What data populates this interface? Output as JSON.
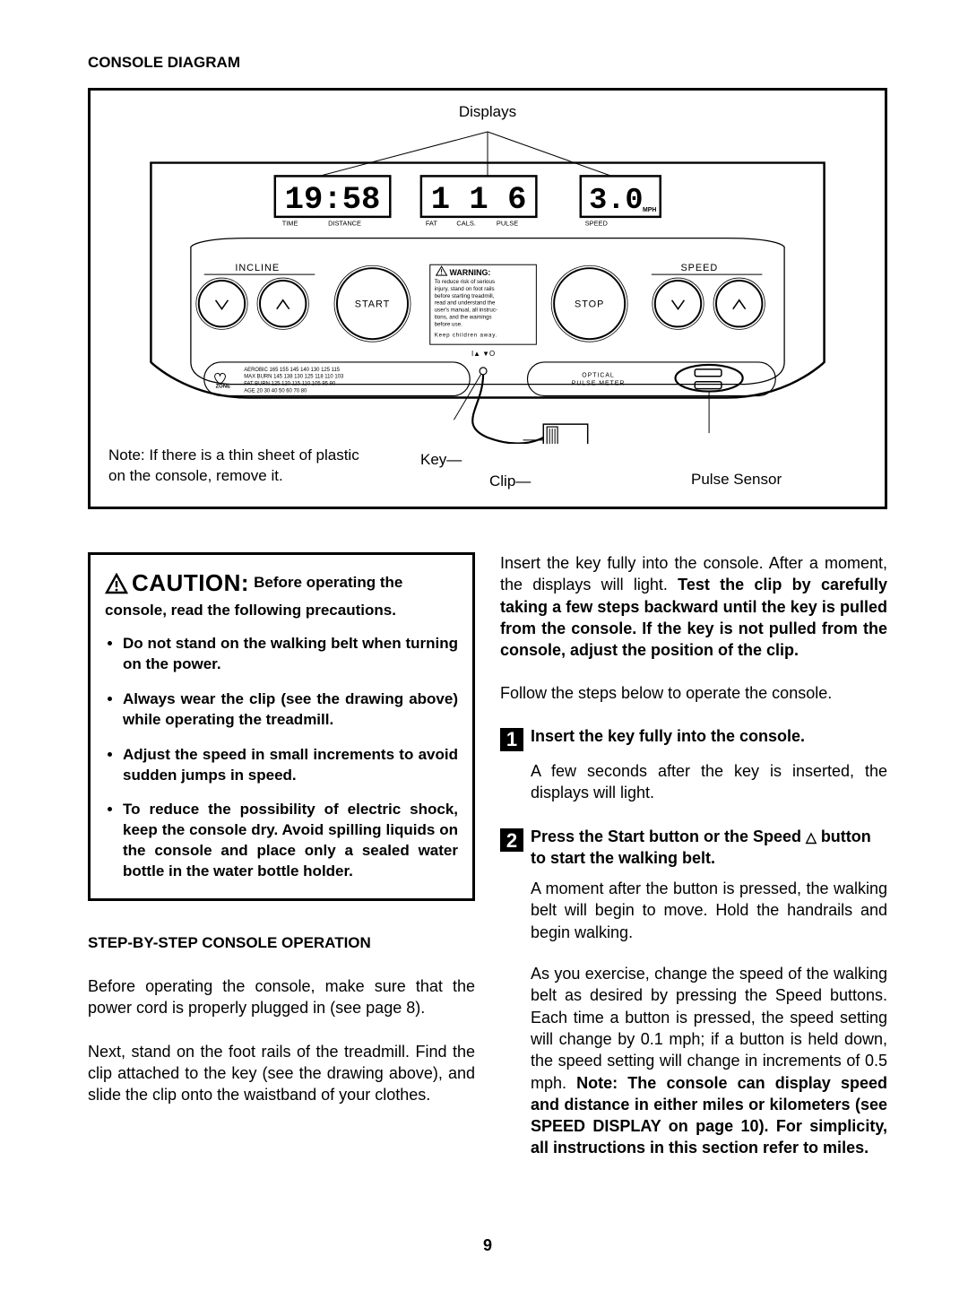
{
  "header": {
    "title": "CONSOLE DIAGRAM"
  },
  "diagram": {
    "callouts": {
      "displays": "Displays",
      "key": "Key",
      "clip": "Clip",
      "pulse_sensor": "Pulse Sensor"
    },
    "note": "Note: If there is a thin sheet of plastic on the console, remove it.",
    "lcds": {
      "time_val": "19:58",
      "fat_val": "1 1 6",
      "speed_val": "3.0",
      "speed_unit": "MPH"
    },
    "lcd_labels": {
      "time": "TIME",
      "distance": "DISTANCE",
      "fat": "FAT",
      "cals": "CALS.",
      "pulse": "PULSE",
      "speed": "SPEED"
    },
    "labels": {
      "incline": "INCLINE",
      "speed": "SPEED",
      "start": "START",
      "stop": "STOP"
    },
    "warning": {
      "title": "WARNING:",
      "lines": [
        "To reduce risk of serious",
        "injury, stand on foot rails",
        "before starting treadmill,",
        "read and understand the",
        "user's manual, all instruc-",
        "tions, and the warnings",
        "before use.",
        "Keep children away."
      ]
    },
    "selectors": "I▲   ▼O",
    "optical": {
      "l1": "OPTICAL",
      "l2": "PULSE METER"
    },
    "zone": {
      "label": "ZONE",
      "rows": [
        "AEROBIC   165  155  145  140  130  125  115",
        "MAX BURN  145  138  130  125  118  110  103",
        "FAT BURN  125  120  115  110  105   95   90",
        "AGE        20   30   40   50   60   70   80"
      ]
    }
  },
  "caution": {
    "big": "CAUTION:",
    "text": "Before operating the console, read the following precautions.",
    "bullets": [
      "Do not stand on the walking belt when turning on the power.",
      "Always wear the clip (see the drawing above) while operating the treadmill.",
      "Adjust the speed in small increments to avoid sudden jumps in speed.",
      "To reduce the possibility of electric shock, keep the console dry. Avoid spilling liquids on the console and place only a sealed water bottle in the water bottle holder."
    ]
  },
  "operation": {
    "subhead": "STEP-BY-STEP CONSOLE OPERATION",
    "p1": "Before operating the console, make sure that the power cord is properly plugged in (see page 8).",
    "p2": "Next, stand on the foot rails of the treadmill. Find the clip attached to the key (see the drawing above), and slide the clip onto the waistband of your clothes."
  },
  "right_intro": {
    "p1_pre": "Insert the key fully into the console. After a moment, the displays will light. ",
    "p1_bold": "Test the clip by carefully taking a few steps backward until the key is pulled from the console. If the key is not pulled from the console, adjust the position of the clip.",
    "p2": "Follow the steps below to operate the console."
  },
  "steps": [
    {
      "num": "1",
      "title": "Insert the key fully into the console.",
      "paras": [
        "A few seconds after the key is inserted, the displays will light."
      ]
    },
    {
      "num": "2",
      "title_pre": "Press the Start button or the Speed ",
      "title_tri": "△",
      "title_post": " button to start the walking belt.",
      "paras": [
        "A moment after the button is pressed, the walking belt will begin to move. Hold the handrails and begin walking."
      ],
      "mixed_para": {
        "pre": "As you exercise, change the speed of the walking belt as desired by pressing the Speed buttons. Each time a button is pressed, the speed setting will change by 0.1 mph; if a button is held down, the speed setting will change in increments of 0.5 mph. ",
        "bold": "Note: The console can display speed and distance in either miles or kilometers (see SPEED DISPLAY on page 10). For simplicity, all instructions in this section refer to miles."
      }
    }
  ],
  "page_number": "9"
}
